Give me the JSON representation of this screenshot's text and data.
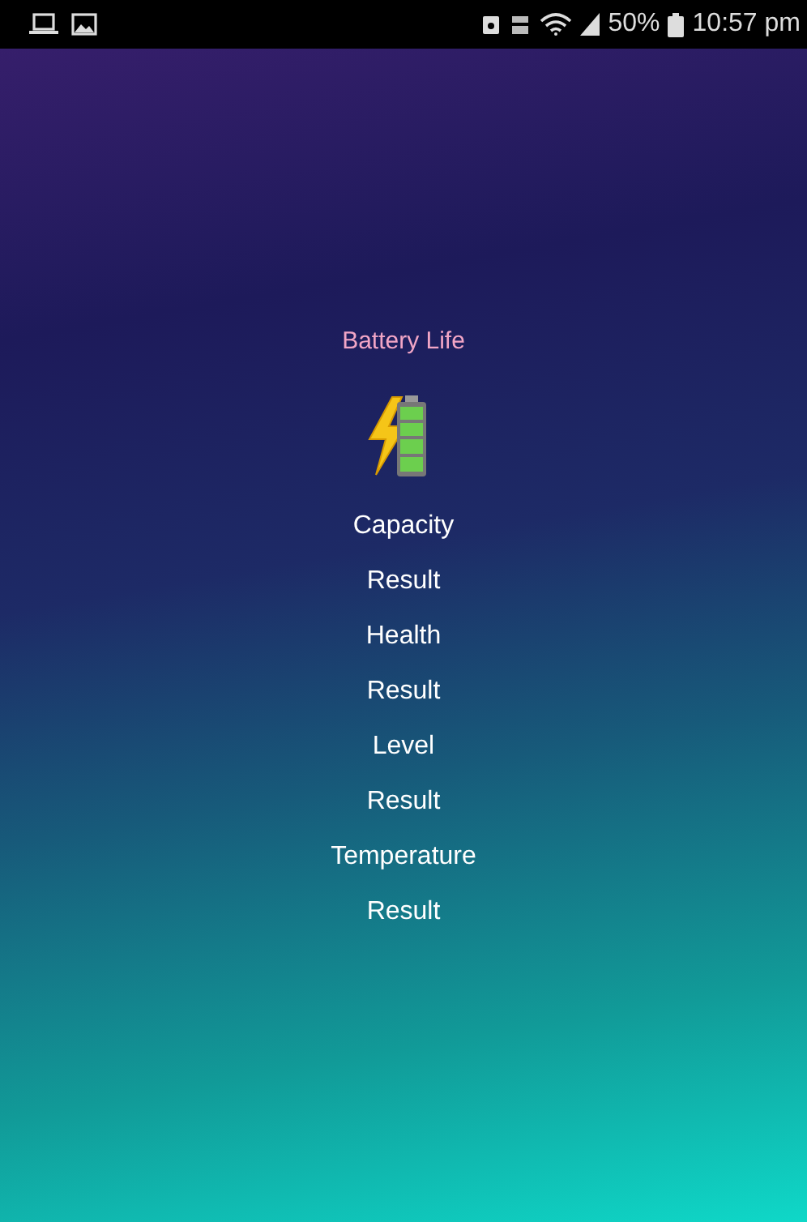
{
  "status_bar": {
    "battery_percent": "50%",
    "time": "10:57 pm"
  },
  "title": "Battery Life",
  "rows": [
    {
      "label": "Capacity",
      "value": "Result"
    },
    {
      "label": "Health",
      "value": "Result"
    },
    {
      "label": "Level",
      "value": "Result"
    },
    {
      "label": "Temperature",
      "value": "Result"
    }
  ]
}
